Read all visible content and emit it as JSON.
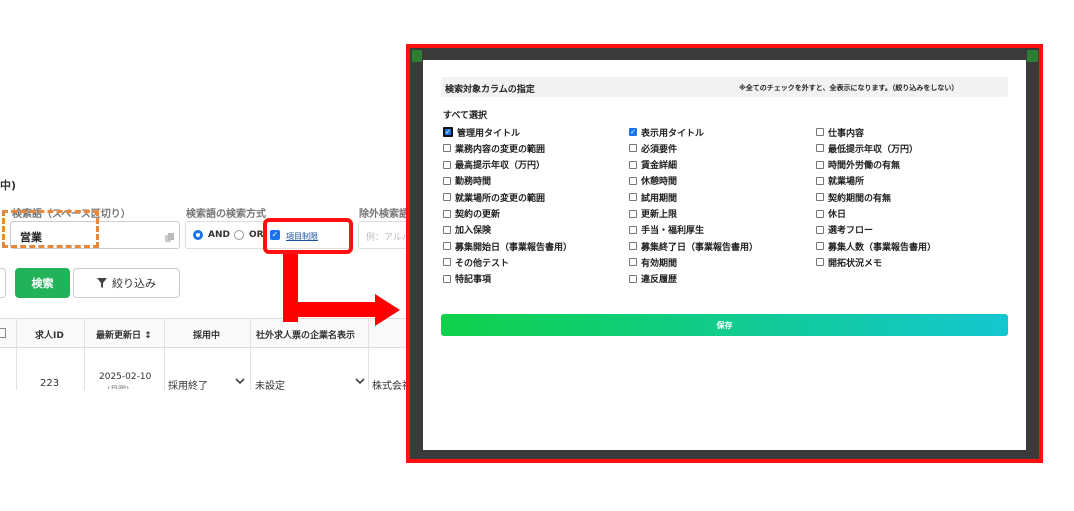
{
  "search_form": {
    "section_heading": "中)",
    "keyword_label": "検索語（スペース区切り）",
    "keyword_value": "営業",
    "mode_label": "検索語の検索方式",
    "mode_and": "AND",
    "mode_or": "OR",
    "column_limit_link": "項目制限",
    "exclude_label": "除外検索語",
    "exclude_placeholder": "例：アルバ",
    "search_button": "検索",
    "filter_button": "絞り込み"
  },
  "table": {
    "headers": [
      "求人ID",
      "最新更新日 ↕",
      "採用中",
      "社外求人票の企業名表示"
    ],
    "row": {
      "id": "223",
      "updated": "2025-02-10",
      "updated_sub": "(月曜)",
      "hiring": "採用終了",
      "company_display": "未設定",
      "company_name": "株式会社"
    }
  },
  "modal": {
    "title": "検索対象カラムの指定",
    "note": "※全てのチェックを外すと、全表示になります。（絞り込みをしない）",
    "select_all": "すべて選択",
    "columns": [
      [
        {
          "label": "管理用タイトル",
          "checked": true
        },
        {
          "label": "業務内容の変更の範囲",
          "checked": false
        },
        {
          "label": "最高提示年収（万円）",
          "checked": false
        },
        {
          "label": "勤務時間",
          "checked": false
        },
        {
          "label": "就業場所の変更の範囲",
          "checked": false
        },
        {
          "label": "契約の更新",
          "checked": false
        },
        {
          "label": "加入保険",
          "checked": false
        },
        {
          "label": "募集開始日（事業報告書用）",
          "checked": false
        },
        {
          "label": "その他テスト",
          "checked": false
        },
        {
          "label": "特記事項",
          "checked": false
        }
      ],
      [
        {
          "label": "表示用タイトル",
          "checked": true
        },
        {
          "label": "必須要件",
          "checked": false
        },
        {
          "label": "賃金詳細",
          "checked": false
        },
        {
          "label": "休憩時間",
          "checked": false
        },
        {
          "label": "試用期間",
          "checked": false
        },
        {
          "label": "更新上限",
          "checked": false
        },
        {
          "label": "手当・福利厚生",
          "checked": false
        },
        {
          "label": "募集終了日（事業報告書用）",
          "checked": false
        },
        {
          "label": "有効期間",
          "checked": false
        },
        {
          "label": "違反履歴",
          "checked": false
        }
      ],
      [
        {
          "label": "仕事内容",
          "checked": false
        },
        {
          "label": "最低提示年収（万円）",
          "checked": false
        },
        {
          "label": "時間外労働の有無",
          "checked": false
        },
        {
          "label": "就業場所",
          "checked": false
        },
        {
          "label": "契約期間の有無",
          "checked": false
        },
        {
          "label": "休日",
          "checked": false
        },
        {
          "label": "選考フロー",
          "checked": false
        },
        {
          "label": "募集人数（事業報告書用）",
          "checked": false
        },
        {
          "label": "開拓状況メモ",
          "checked": false
        }
      ]
    ],
    "save_button": "保存"
  },
  "colors": {
    "highlight_red": "#ff1010",
    "dashed_orange": "#e8883b",
    "search_green": "#22b35a",
    "checkbox_blue": "#1a73e8"
  }
}
